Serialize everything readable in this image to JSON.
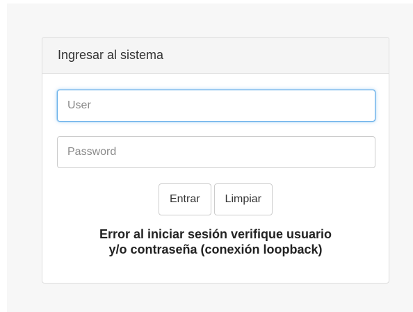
{
  "login_panel": {
    "title": "Ingresar al sistema",
    "user_placeholder": "User",
    "user_value": "",
    "password_placeholder": "Password",
    "password_value": "",
    "submit_label": "Entrar",
    "clear_label": "Limpiar",
    "error_line1": "Error al iniciar sesión verifique usuario",
    "error_line2": "y/o contraseña (conexión loopback)"
  },
  "colors": {
    "panel_heading_bg": "#f5f5f5",
    "focus_border": "#66afe9",
    "page_bg": "#f7f7f7"
  }
}
